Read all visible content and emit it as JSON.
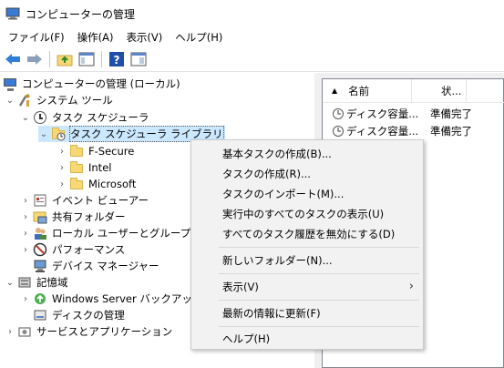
{
  "window": {
    "title": "コンピューターの管理"
  },
  "menubar": [
    "ファイル(F)",
    "操作(A)",
    "表示(V)",
    "ヘルプ(H)"
  ],
  "toolbar": {
    "buttons": [
      "back-arrow-icon",
      "forward-arrow-icon",
      "up-folder-icon",
      "show-hide-console-tree-icon",
      "help-icon",
      "show-hide-action-pane-icon"
    ]
  },
  "tree": {
    "root": "コンピューターの管理 (ローカル)",
    "system_tools": "システム ツール",
    "task_scheduler": "タスク スケジューラ",
    "task_scheduler_library": "タスク スケジューラ ライブラリ",
    "fsecure": "F-Secure",
    "intel": "Intel",
    "microsoft": "Microsoft",
    "event_viewer": "イベント ビューアー",
    "shared_folders": "共有フォルダー",
    "local_users": "ローカル ユーザーとグループ",
    "performance": "パフォーマンス",
    "device_manager": "デバイス マネージャー",
    "storage": "記憶域",
    "windows_backup": "Windows Server バックアップ",
    "disk_management": "ディスクの管理",
    "services_apps": "サービスとアプリケーション"
  },
  "listview": {
    "columns": [
      "名前",
      "状...",
      ""
    ],
    "rows": [
      {
        "name": "ディスク容量...",
        "status": "準備完了"
      },
      {
        "name": "ディスク容量...",
        "status": "準備完了"
      }
    ]
  },
  "context_menu": {
    "items": [
      "基本タスクの作成(B)...",
      "タスクの作成(R)...",
      "タスクのインポート(M)...",
      "実行中のすべてのタスクの表示(U)",
      "すべてのタスク履歴を無効にする(D)",
      "新しいフォルダー(N)...",
      "表示(V)",
      "最新の情報に更新(F)",
      "ヘルプ(H)"
    ],
    "submenu_arrow": "›"
  },
  "colors": {
    "selection": "#cce8ff",
    "menu_bg": "#f2f2f2",
    "accent": "#0078d7"
  }
}
